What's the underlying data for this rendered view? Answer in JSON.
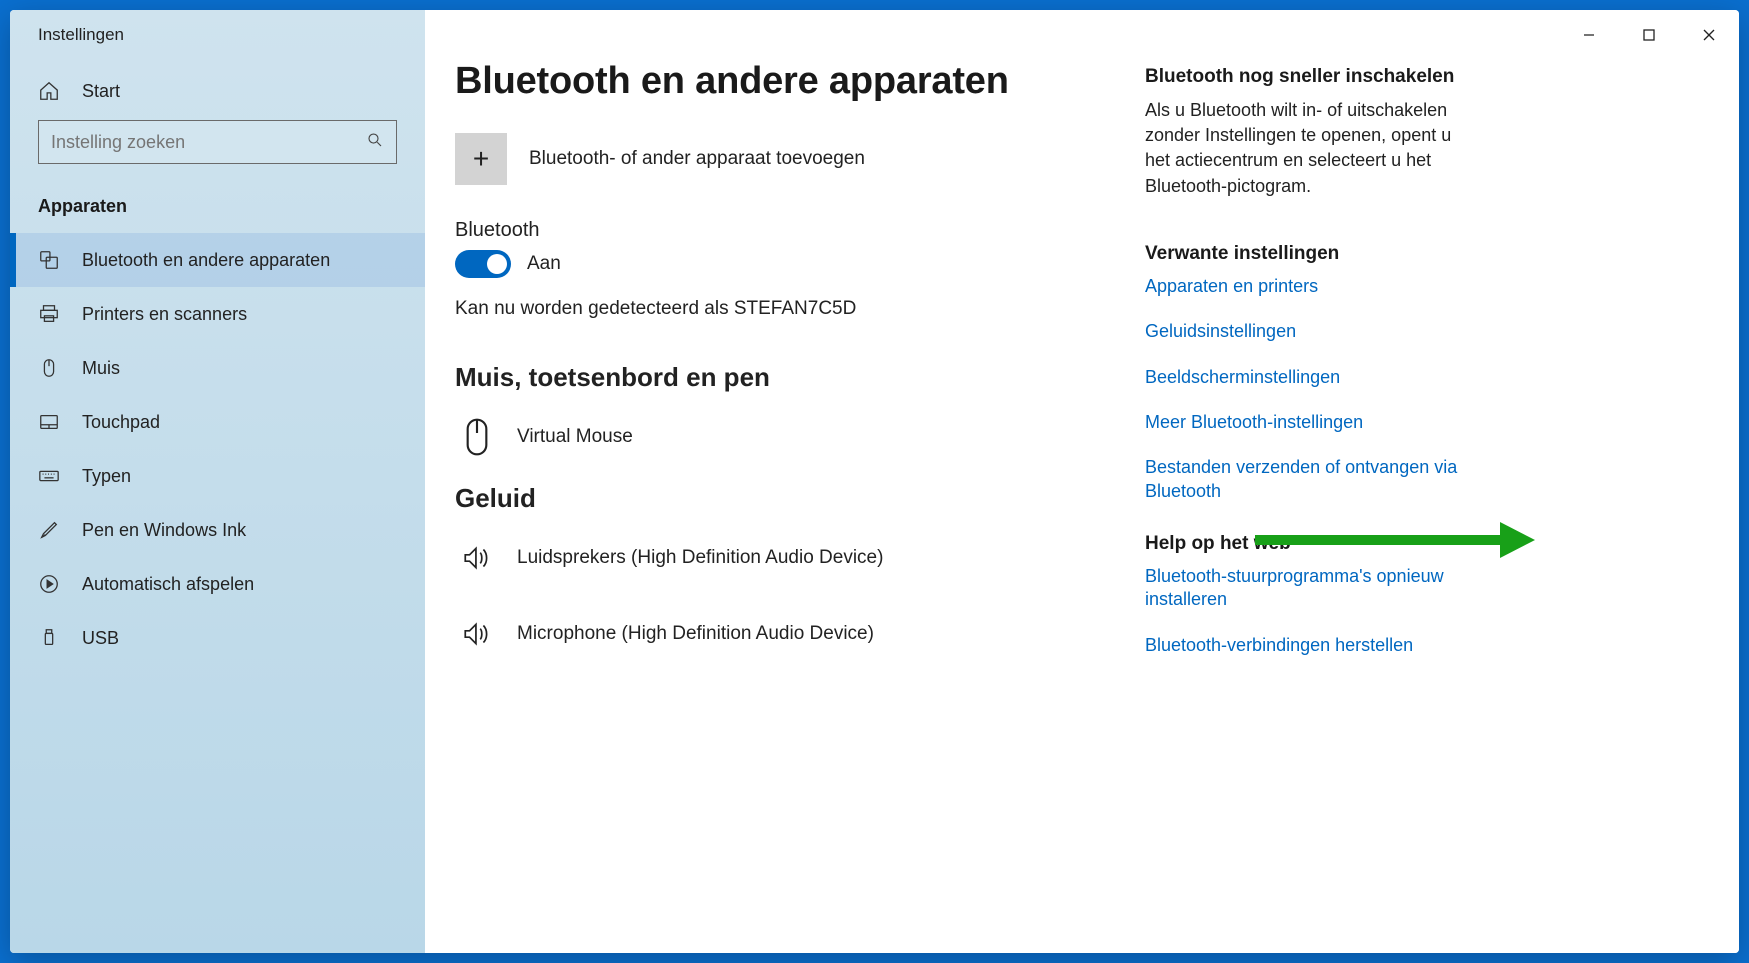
{
  "window": {
    "title": "Instellingen"
  },
  "home": {
    "label": "Start"
  },
  "search": {
    "placeholder": "Instelling zoeken"
  },
  "category_header": "Apparaten",
  "nav": [
    {
      "label": "Bluetooth en andere apparaten",
      "active": true
    },
    {
      "label": "Printers en scanners"
    },
    {
      "label": "Muis"
    },
    {
      "label": "Touchpad"
    },
    {
      "label": "Typen"
    },
    {
      "label": "Pen en Windows Ink"
    },
    {
      "label": "Automatisch afspelen"
    },
    {
      "label": "USB"
    }
  ],
  "page": {
    "title": "Bluetooth en andere apparaten",
    "add_device": "Bluetooth- of ander apparaat toevoegen",
    "bluetooth_label": "Bluetooth",
    "toggle_state": "Aan",
    "detectable": "Kan nu worden gedetecteerd als STEFAN7C5D",
    "section_mouse": "Muis, toetsenbord en pen",
    "device_mouse": "Virtual Mouse",
    "section_sound": "Geluid",
    "device_speakers": "Luidsprekers (High Definition Audio Device)",
    "device_mic": "Microphone (High Definition Audio Device)"
  },
  "aside": {
    "quick_title": "Bluetooth nog sneller inschakelen",
    "quick_text": "Als u Bluetooth wilt in- of uitschakelen zonder Instellingen te openen, opent u het actiecentrum en selecteert u het Bluetooth-pictogram.",
    "related_title": "Verwante instellingen",
    "links_related": [
      "Apparaten en printers",
      "Geluidsinstellingen",
      "Beeldscherminstellingen",
      "Meer Bluetooth-instellingen",
      "Bestanden verzenden of ontvangen via Bluetooth"
    ],
    "help_title": "Help op het web",
    "links_help": [
      "Bluetooth-stuurprogramma's opnieuw installeren",
      "Bluetooth-verbindingen herstellen"
    ]
  }
}
